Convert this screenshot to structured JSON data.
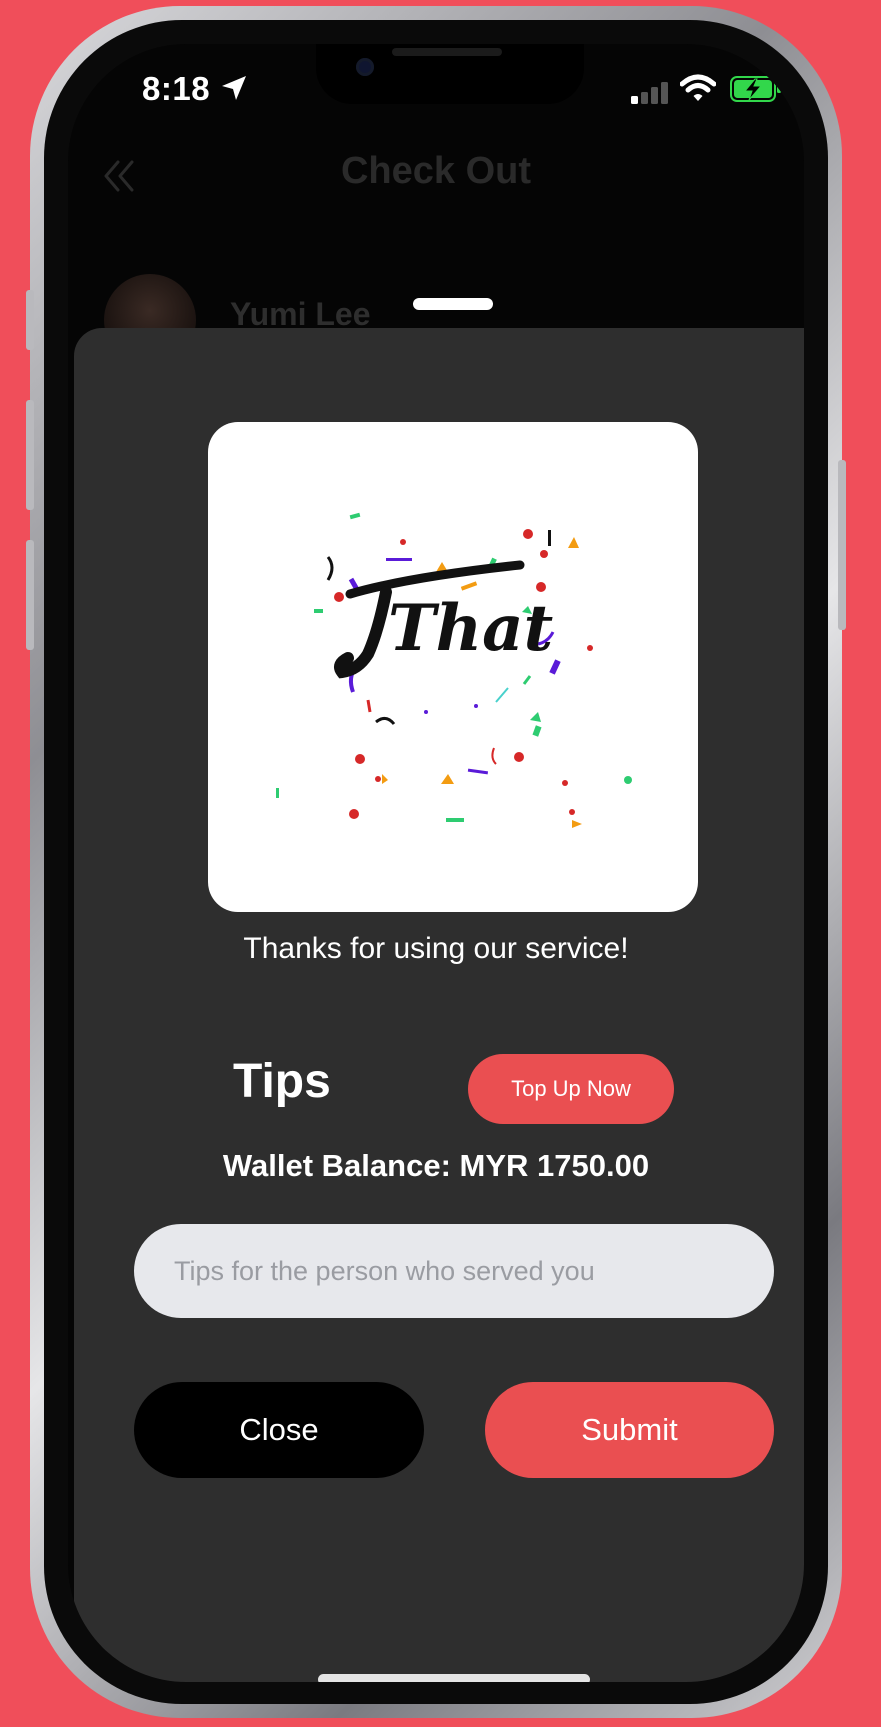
{
  "status_bar": {
    "time": "8:18",
    "location_icon": "location-arrow-icon",
    "signal_icon": "cellular-signal-icon",
    "wifi_icon": "wifi-icon",
    "battery_icon": "battery-charging-icon",
    "battery_color": "#32d74b"
  },
  "background_screen": {
    "title": "Check Out",
    "back_icon": "double-chevron-left-icon",
    "user_name": "Yumi Lee"
  },
  "modal": {
    "image_logo_text": "That",
    "thanks_message": "Thanks for using our service!",
    "tips_heading": "Tips",
    "top_up_label": "Top Up Now",
    "wallet_balance": "Wallet Balance: MYR 1750.00",
    "tips_input": {
      "value": "",
      "placeholder": "Tips for the person who served you"
    },
    "close_label": "Close",
    "submit_label": "Submit"
  },
  "colors": {
    "background": "#f04e5a",
    "accent": "#ea4f51",
    "sheet": "#2e2e2e",
    "input": "#e7e8ec"
  }
}
